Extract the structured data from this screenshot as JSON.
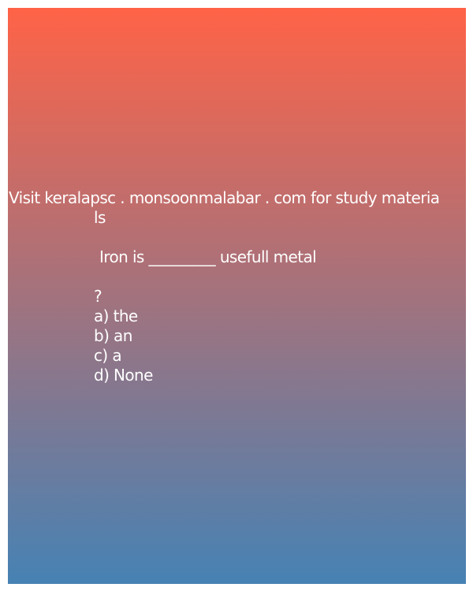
{
  "header": {
    "line1": "Visit keralapsc . monsoonmalabar . com for study materia",
    "line2": "ls"
  },
  "question": {
    "text": "Iron is _________ usefull metal",
    "mark": "?"
  },
  "options": [
    {
      "label": "a) the"
    },
    {
      "label": "b) an"
    },
    {
      "label": "c) a"
    },
    {
      "label": "d) None"
    }
  ],
  "colors": {
    "gradient_top": "#ff6347",
    "gradient_bottom": "#4682b4",
    "text": "#ffffff",
    "page_background": "#ffffff"
  }
}
